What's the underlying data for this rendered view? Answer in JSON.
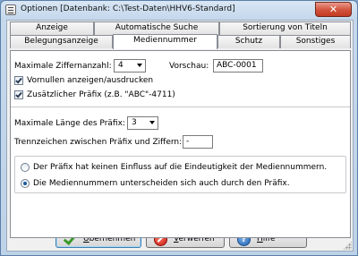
{
  "window": {
    "title": "Optionen  [Datenbank: C:\\Test-Daten\\HHV6-Standard]",
    "close_glyph": "✕"
  },
  "tabs_row1": [
    {
      "label": "Anzeige"
    },
    {
      "label": "Automatische Suche"
    },
    {
      "label": "Sortierung von Titeln"
    }
  ],
  "tabs_row2": [
    {
      "label": "Belegungsanzeige"
    },
    {
      "label": "Mediennummer",
      "active": true
    },
    {
      "label": "Schutz"
    },
    {
      "label": "Sonstiges"
    }
  ],
  "form": {
    "max_digits_label": "Maximale Ziffernanzahl:",
    "max_digits_value": "4",
    "preview_label": "Vorschau:",
    "preview_value": "ABC-0001",
    "leading_zeros_label": "Vornullen anzeigen/ausdrucken",
    "leading_zeros_checked": true,
    "prefix_label": "Zusätzlicher Präfix (z.B. \"ABC\"-4711)",
    "prefix_checked": true,
    "max_prefix_len_label": "Maximale Länge des Präfix:",
    "max_prefix_len_value": "3",
    "separator_label": "Trennzeichen zwischen Präfix und Ziffern:",
    "separator_value": "-",
    "radio_options": [
      {
        "label": "Der Präfix hat keinen Einfluss auf die Eindeutigkeit der Mediennummern.",
        "selected": false
      },
      {
        "label": "Die Mediennummern unterscheiden sich auch durch den Präfix.",
        "selected": true
      }
    ]
  },
  "buttons": {
    "ok": {
      "label_u": "Ü",
      "label_rest": "bernehmen",
      "icon": "checkmark-icon"
    },
    "cancel": {
      "label_u": "V",
      "label_rest": "erwerfen",
      "icon": "no-entry-icon"
    },
    "help": {
      "label_u": "H",
      "label_rest": "ilfe",
      "icon": "help-icon",
      "icon_glyph": "?"
    }
  }
}
